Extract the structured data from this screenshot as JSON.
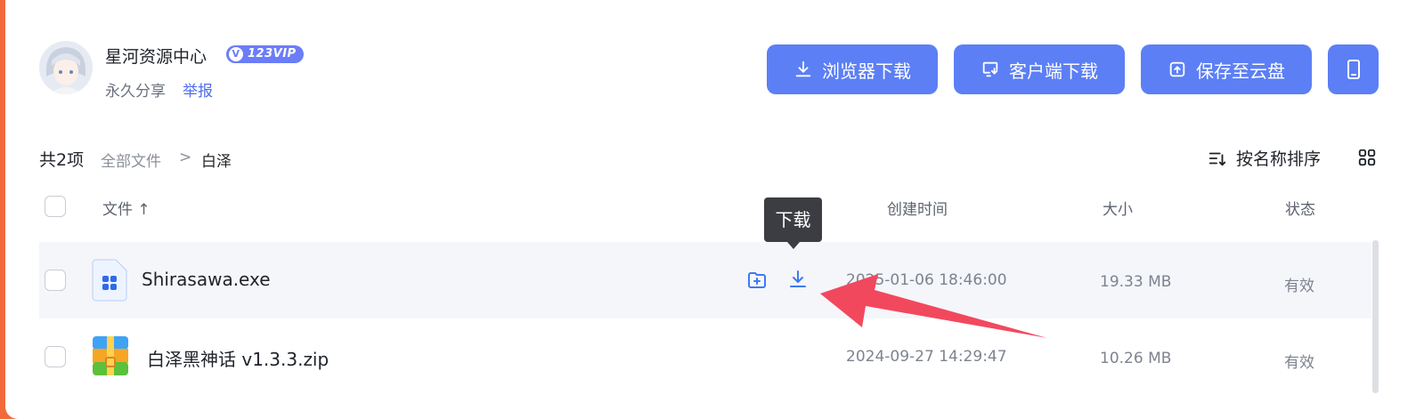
{
  "owner": {
    "name": "星河资源中心",
    "vip_label": "123VIP",
    "share_type": "永久分享",
    "report": "举报"
  },
  "actions": {
    "browser_download": "浏览器下载",
    "client_download": "客户端下载",
    "save_to_cloud": "保存至云盘"
  },
  "toolbar": {
    "count": "共2项",
    "breadcrumb": {
      "all": "全部文件",
      "separator": ">",
      "current": "白泽"
    },
    "sort": "按名称排序"
  },
  "columns": {
    "file": "文件 ↑",
    "created": "创建时间",
    "size": "大小",
    "status": "状态"
  },
  "files": [
    {
      "name": "Shirasawa.exe",
      "created": "2025-01-06 18:46:00",
      "size": "19.33 MB",
      "status": "有效"
    },
    {
      "name": "白泽黑神话 v1.3.3.zip",
      "created": "2024-09-27 14:29:47",
      "size": "10.26 MB",
      "status": "有效"
    }
  ],
  "tooltip": "下载",
  "colors": {
    "accent": "#5c7ff5",
    "annotation_arrow": "#f2485e",
    "frame": "#f26a3c"
  }
}
